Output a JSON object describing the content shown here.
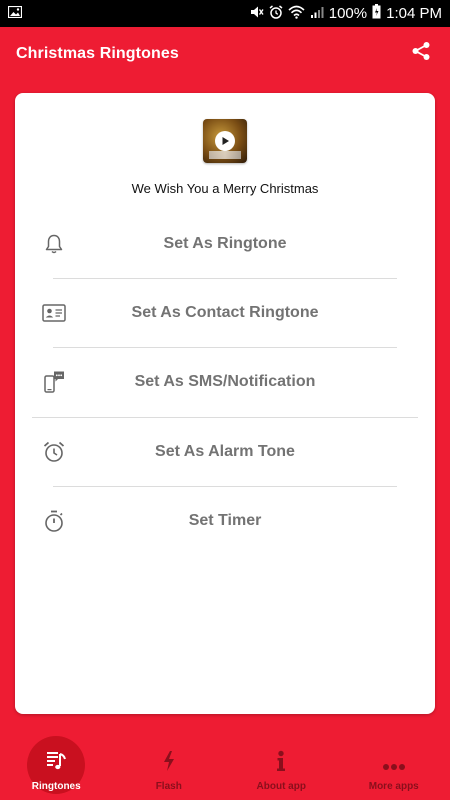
{
  "status_bar": {
    "battery": "100%",
    "time": "1:04 PM",
    "icons": [
      "image-icon",
      "mute-icon",
      "alarm-icon",
      "wifi-icon",
      "signal-icon",
      "battery-icon"
    ]
  },
  "app_bar": {
    "title": "Christmas Ringtones",
    "share_icon": "share-icon"
  },
  "card": {
    "song_title": "We Wish You a Merry Christmas",
    "cover_icon": "play-icon",
    "actions": [
      {
        "label": "Set As Ringtone",
        "icon": "bell-icon"
      },
      {
        "label": "Set As Contact Ringtone",
        "icon": "contact-card-icon"
      },
      {
        "label": "Set As SMS/Notification",
        "icon": "sms-phone-icon"
      },
      {
        "label": "Set As Alarm Tone",
        "icon": "alarm-clock-icon"
      },
      {
        "label": "Set Timer",
        "icon": "timer-icon"
      }
    ]
  },
  "bottom_nav": {
    "items": [
      {
        "label": "Ringtones",
        "icon": "music-list-icon",
        "active": true
      },
      {
        "label": "Flash",
        "icon": "flash-icon",
        "active": false
      },
      {
        "label": "About app",
        "icon": "info-icon",
        "active": false
      },
      {
        "label": "More apps",
        "icon": "more-dots-icon",
        "active": false
      }
    ]
  },
  "colors": {
    "primary": "#ee1c33",
    "nav_active_circle": "#c9101f",
    "nav_inactive": "#8a0f1c",
    "action_text": "#737373"
  }
}
